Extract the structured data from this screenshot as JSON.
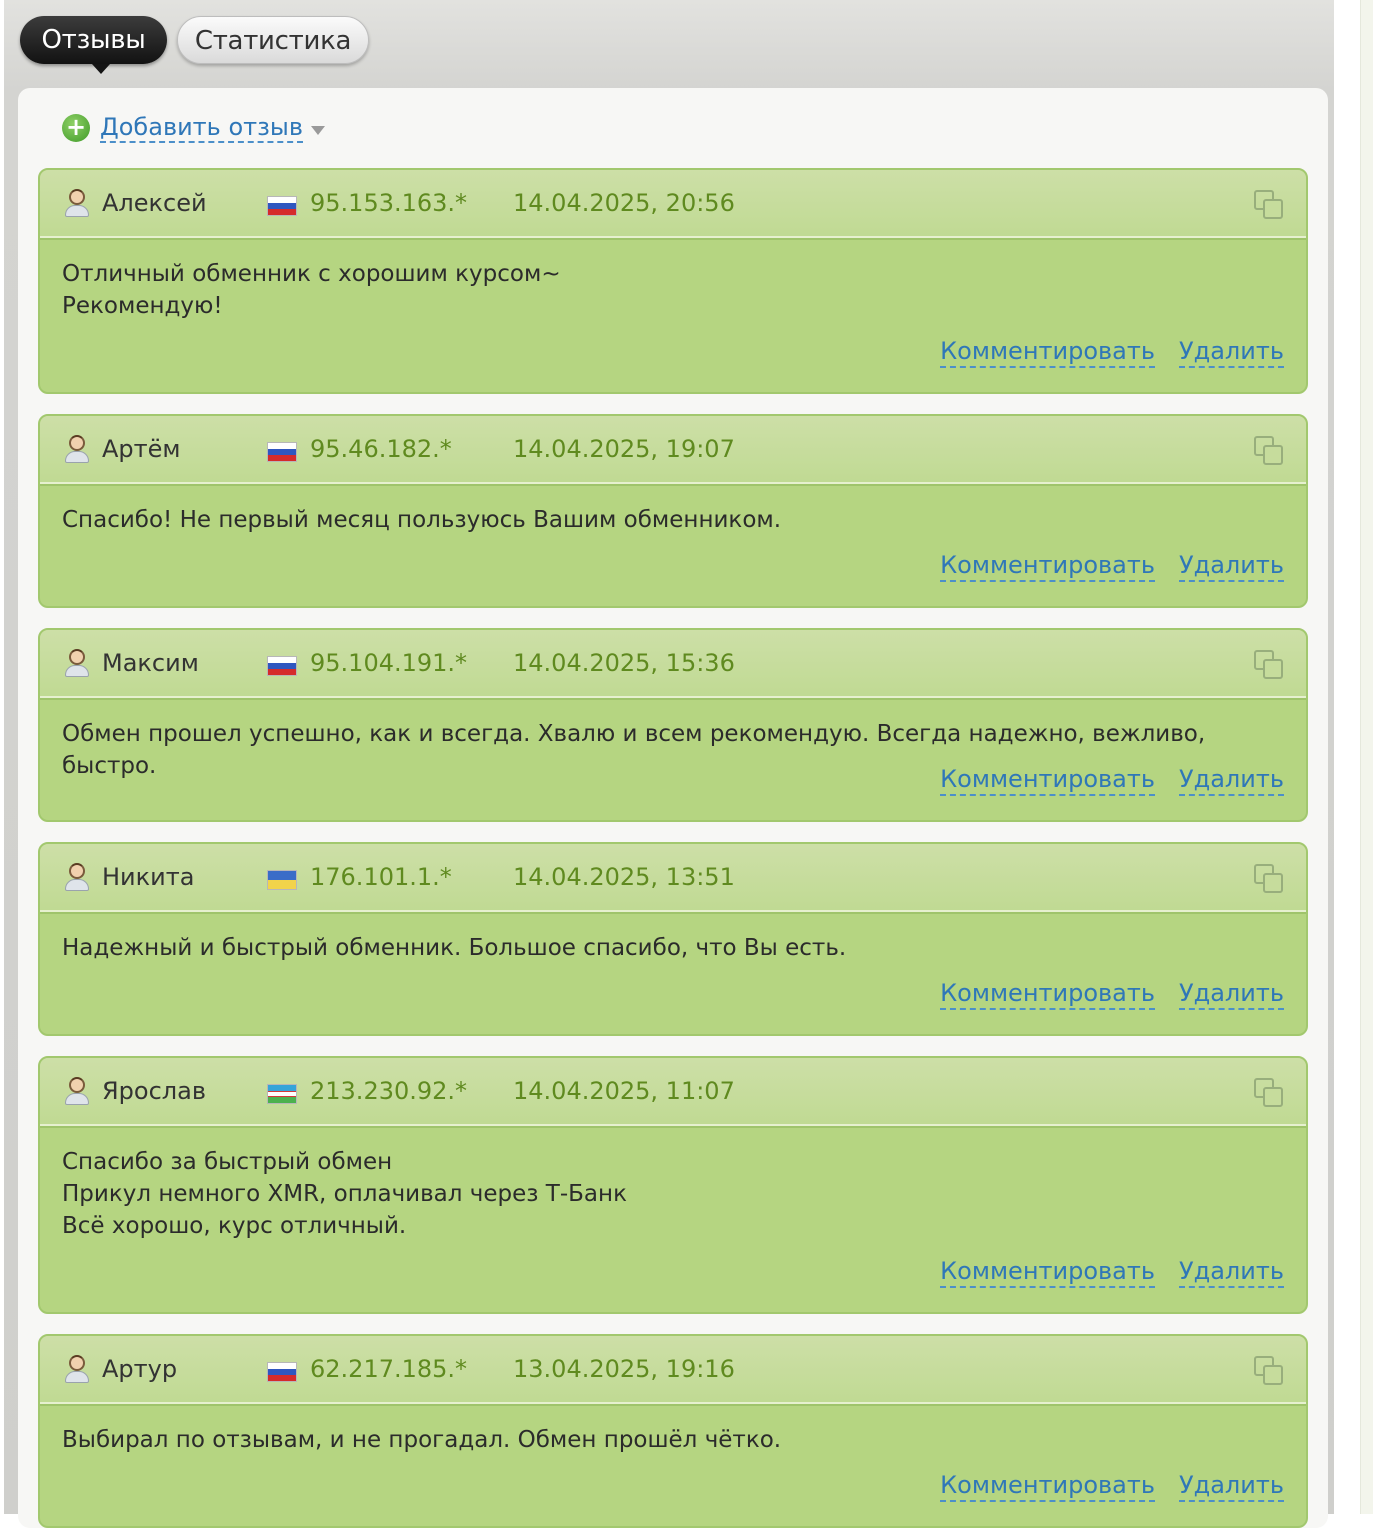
{
  "tabs": [
    {
      "label": "Отзывы",
      "active": true
    },
    {
      "label": "Статистика",
      "active": false
    }
  ],
  "add_review": {
    "label": "Добавить отзыв"
  },
  "actions": {
    "comment": "Комментировать",
    "delete": "Удалить"
  },
  "reviews": [
    {
      "name": "Алексей",
      "country": "ru",
      "ip": "95.153.163.*",
      "date": "14.04.2025, 20:56",
      "lines": [
        "Отличный обменник с хорошим курсом~",
        "Рекомендую!"
      ]
    },
    {
      "name": "Артём",
      "country": "ru",
      "ip": "95.46.182.*",
      "date": "14.04.2025, 19:07",
      "lines": [
        "Спасибо! Не первый месяц пользуюсь Вашим обменником."
      ]
    },
    {
      "name": "Максим",
      "country": "ru",
      "ip": "95.104.191.*",
      "date": "14.04.2025, 15:36",
      "lines": [
        "Обмен прошел успешно, как и всегда. Хвалю и всем рекомендую. Всегда надежно, вежливо, быстро."
      ]
    },
    {
      "name": "Никита",
      "country": "ua",
      "ip": "176.101.1.*",
      "date": "14.04.2025, 13:51",
      "lines": [
        "Надежный и быстрый обменник. Большое спасибо, что Вы есть."
      ]
    },
    {
      "name": "Ярослав",
      "country": "uz",
      "ip": "213.230.92.*",
      "date": "14.04.2025, 11:07",
      "lines": [
        "Спасибо за быстрый обмен",
        "Прикул немного XMR, оплачивал через Т-Банк",
        "Всё хорошо, курс отличный."
      ]
    },
    {
      "name": "Артур",
      "country": "ru",
      "ip": "62.217.185.*",
      "date": "13.04.2025, 19:16",
      "lines": [
        "Выбирал по отзывам, и не прогадал. Обмен прошёл чётко."
      ]
    }
  ]
}
